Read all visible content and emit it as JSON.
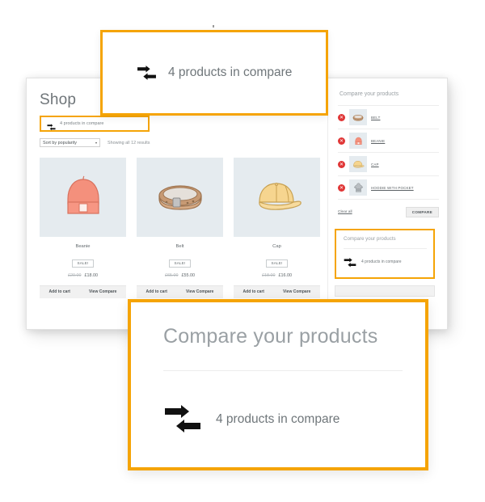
{
  "shop": {
    "title": "Shop",
    "compare_link": {
      "icon": "compare-arrows-icon",
      "label": "4 products in compare"
    },
    "toolbar": {
      "sort_value": "Sort by popularity",
      "sort_caret": "▾",
      "result_count": "Showing all 12 results"
    },
    "products": [
      {
        "name": "Beanie",
        "badge": "SALE!",
        "old_price": "£20.00",
        "new_price": "£18.00",
        "add_to_cart": "Add to cart",
        "view_compare": "View Compare",
        "image": "beanie-illustration"
      },
      {
        "name": "Belt",
        "badge": "SALE!",
        "old_price": "£65.00",
        "new_price": "£55.00",
        "add_to_cart": "Add to cart",
        "view_compare": "View Compare",
        "image": "belt-illustration"
      },
      {
        "name": "Cap",
        "badge": "SALE!",
        "old_price": "£18.00",
        "new_price": "£16.00",
        "add_to_cart": "Add to cart",
        "view_compare": "View Compare",
        "image": "cap-illustration"
      }
    ]
  },
  "aside": {
    "title": "Compare your products",
    "remove_glyph": "✕",
    "items": [
      {
        "name": "BELT",
        "thumb": "belt-thumb"
      },
      {
        "name": "BEANIE",
        "thumb": "beanie-thumb"
      },
      {
        "name": "CAP",
        "thumb": "cap-thumb"
      },
      {
        "name": "HOODIE WITH POCKET",
        "thumb": "hoodie-thumb"
      }
    ],
    "clear_all": "Clear all",
    "compare_button": "COMPARE"
  },
  "widget": {
    "title": "Compare your products",
    "icon": "compare-arrows-icon",
    "label": "4 products in compare"
  },
  "callout_top": {
    "icon": "compare-arrows-icon",
    "label": "4 products in compare"
  },
  "callout_bottom": {
    "title": "Compare your products",
    "icon": "compare-arrows-icon",
    "label": "4 products in compare"
  },
  "colors": {
    "accent": "#F5A406",
    "text_muted": "#9AA0A4",
    "text_body": "#6F767A",
    "thumb_bg": "#E5EBEF",
    "remove_red": "#E03636"
  }
}
